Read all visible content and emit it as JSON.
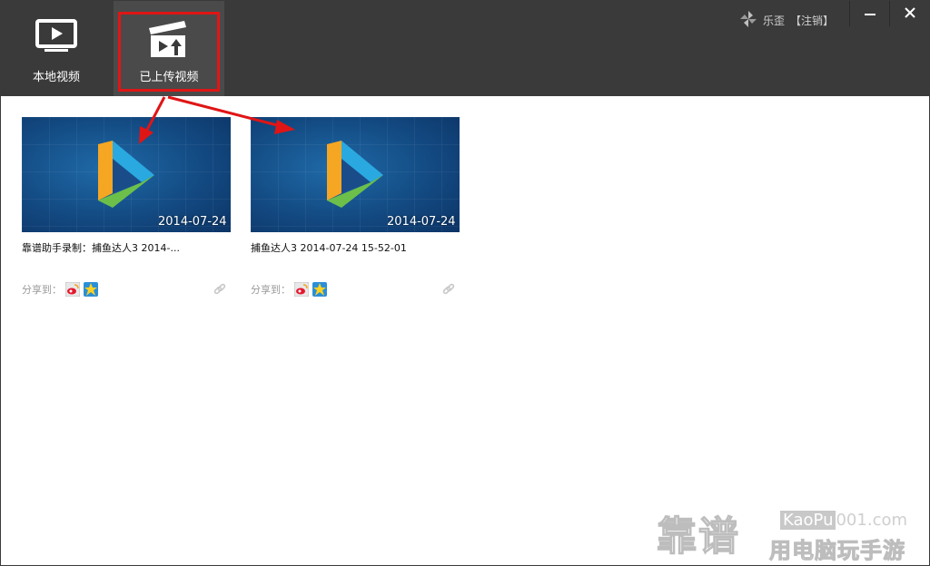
{
  "nav": {
    "tabs": [
      {
        "label": "本地视频",
        "icon": "tv-icon"
      },
      {
        "label": "已上传视频",
        "icon": "clapperboard-upload-icon"
      }
    ]
  },
  "user": {
    "name": "乐歪",
    "logout_label": "【注销】"
  },
  "videos": [
    {
      "thumb_date": "2014-07-24",
      "title": "靠谱助手录制：捕鱼达人3 2014-...",
      "share_label": "分享到："
    },
    {
      "thumb_date": "2014-07-24",
      "title": "捕鱼达人3 2014-07-24 15-52-01",
      "share_label": "分享到："
    }
  ],
  "watermark": {
    "big": "靠谱",
    "site_prefix": "KaoPu",
    "site_suffix": "001.com",
    "subtitle": "用电脑玩手游"
  },
  "colors": {
    "header": "#3a3a3a",
    "highlight": "#e01515",
    "thumb_blue": "#134a82"
  }
}
